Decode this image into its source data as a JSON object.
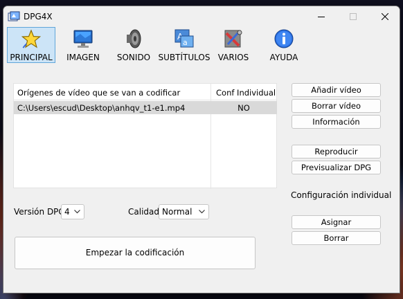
{
  "window": {
    "title": "DPG4X"
  },
  "tabs": [
    {
      "label": "PRINCIPAL",
      "icon": "star-icon",
      "active": true
    },
    {
      "label": "IMAGEN",
      "icon": "monitor-icon"
    },
    {
      "label": "SONIDO",
      "icon": "speaker-icon"
    },
    {
      "label": "SUBTÍTULOS",
      "icon": "subtitles-icon"
    },
    {
      "label": "VARIOS",
      "icon": "tools-icon"
    },
    {
      "label": "AYUDA",
      "icon": "info-icon"
    }
  ],
  "list": {
    "headers": [
      "Orígenes de vídeo que se van a codificar",
      "Conf Individual"
    ],
    "rows": [
      {
        "path": "C:\\Users\\escud\\Desktop\\anhqv_t1-e1.mp4",
        "conf": "NO"
      }
    ]
  },
  "buttons": {
    "add": "Añadir vídeo",
    "remove": "Borrar vídeo",
    "info": "Información",
    "play": "Reproducir",
    "preview": "Previsualizar DPG",
    "assign": "Asignar",
    "clear": "Borrar",
    "start": "Empezar la codificación"
  },
  "individual_config_label": "Configuración individual",
  "dpg_version": {
    "label": "Versión DPG",
    "value": "4"
  },
  "quality": {
    "label": "Calidad",
    "value": "Normal"
  },
  "colors": {
    "tab_active_bg": "#cce4f7",
    "tab_active_border": "#5fa5d9",
    "row_selected": "#d9d9d9"
  }
}
